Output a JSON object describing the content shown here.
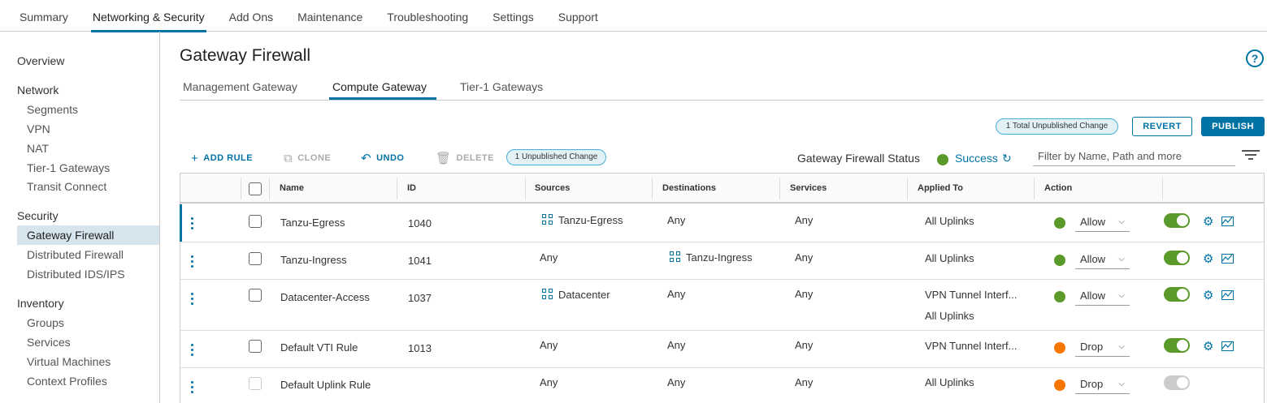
{
  "top_tabs": [
    "Summary",
    "Networking & Security",
    "Add Ons",
    "Maintenance",
    "Troubleshooting",
    "Settings",
    "Support"
  ],
  "sidebar": {
    "overview": "Overview",
    "network_header": "Network",
    "network_items": [
      "Segments",
      "VPN",
      "NAT",
      "Tier-1 Gateways",
      "Transit Connect"
    ],
    "security_header": "Security",
    "security_items": [
      "Gateway Firewall",
      "Distributed Firewall",
      "Distributed IDS/IPS"
    ],
    "inventory_header": "Inventory",
    "inventory_items": [
      "Groups",
      "Services",
      "Virtual Machines",
      "Context Profiles"
    ]
  },
  "page": {
    "title": "Gateway Firewall",
    "help": "?",
    "sub_tabs": [
      "Management Gateway",
      "Compute Gateway",
      "Tier-1 Gateways"
    ]
  },
  "actions": {
    "total_changes_badge": "1 Total Unpublished Change",
    "revert": "REVERT",
    "publish": "PUBLISH"
  },
  "toolbar": {
    "add_rule": "ADD RULE",
    "clone": "CLONE",
    "undo": "UNDO",
    "delete": "DELETE",
    "unpublished_badge": "1 Unpublished Change",
    "status_label": "Gateway Firewall Status",
    "status_value": "Success",
    "filter_placeholder": "Filter by Name, Path and more"
  },
  "table": {
    "headers": [
      "Name",
      "ID",
      "Sources",
      "Destinations",
      "Services",
      "Applied To",
      "Action"
    ],
    "rows": [
      {
        "name": "Tanzu-Egress",
        "id": "1040",
        "sources": "Tanzu-Egress",
        "destinations": "Any",
        "services": "Any",
        "applied_to": [
          "All Uplinks"
        ],
        "action": "Allow",
        "enabled": true
      },
      {
        "name": "Tanzu-Ingress",
        "id": "1041",
        "sources": "Any",
        "destinations": "Tanzu-Ingress",
        "services": "Any",
        "applied_to": [
          "All Uplinks"
        ],
        "action": "Allow",
        "enabled": true
      },
      {
        "name": "Datacenter-Access",
        "id": "1037",
        "sources": "Datacenter",
        "destinations": "Any",
        "services": "Any",
        "applied_to": [
          "VPN Tunnel Interf...",
          "All Uplinks"
        ],
        "action": "Allow",
        "enabled": true
      },
      {
        "name": "Default VTI Rule",
        "id": "1013",
        "sources": "Any",
        "destinations": "Any",
        "services": "Any",
        "applied_to": [
          "VPN Tunnel Interf..."
        ],
        "action": "Drop",
        "enabled": true
      },
      {
        "name": "Default Uplink Rule",
        "id": "",
        "sources": "Any",
        "destinations": "Any",
        "services": "Any",
        "applied_to": [
          "All Uplinks"
        ],
        "action": "Drop",
        "enabled": false
      }
    ]
  },
  "colors": {
    "accent": "#0072a3",
    "allow": "#5a9a2a",
    "drop": "#f57600",
    "success": "#5a9a2a"
  }
}
